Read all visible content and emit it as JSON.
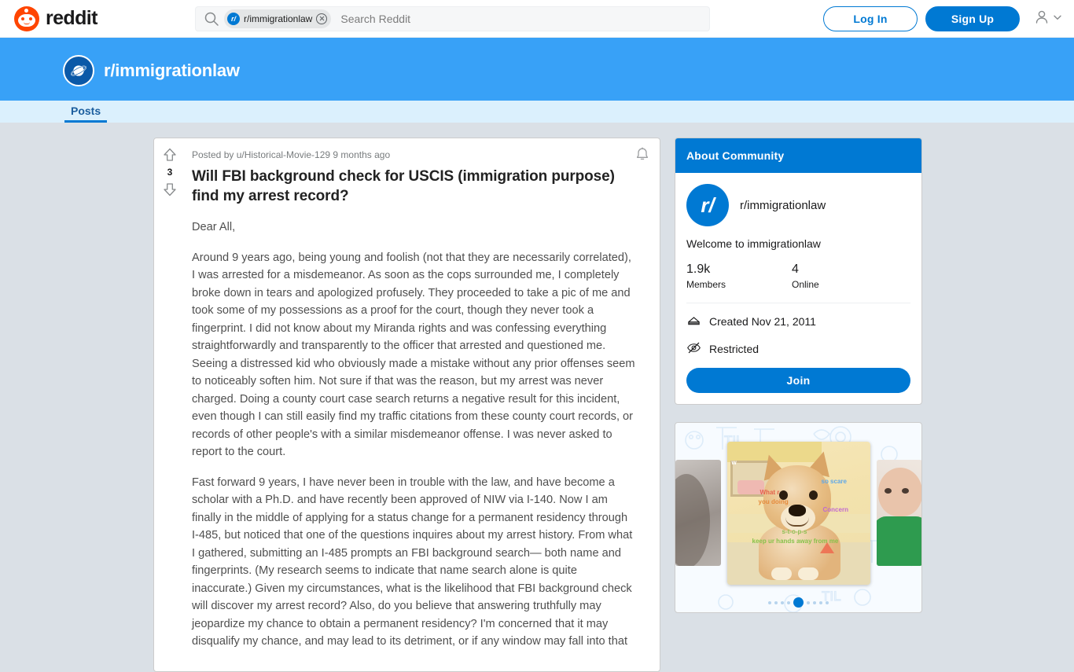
{
  "header": {
    "brand_name": "reddit",
    "brand_icon": "reddit-snoo-icon",
    "search": {
      "icon": "search-icon",
      "pill_avatar_text": "r/",
      "pill_label": "r/immigrationlaw",
      "close_icon": "close-icon",
      "placeholder": "Search Reddit",
      "value": ""
    },
    "login_label": "Log In",
    "signup_label": "Sign Up",
    "user_icon": "user-avatar-icon",
    "chevron_icon": "chevron-down-icon"
  },
  "banner": {
    "icon": "planet-icon",
    "title": "r/immigrationlaw",
    "background_color": "#38a1f7"
  },
  "tabs": [
    {
      "label": "Posts",
      "active": true
    }
  ],
  "post": {
    "vote": {
      "up_icon": "upvote-arrow-icon",
      "down_icon": "downvote-arrow-icon",
      "score": "3"
    },
    "notify_icon": "bell-icon",
    "meta": "Posted by u/Historical-Movie-129 9 months ago",
    "title": "Will FBI background check for USCIS (immigration purpose) find my arrest record?",
    "paragraphs": [
      "Dear All,",
      "Around 9 years ago, being young and foolish (not that they are necessarily correlated), I was arrested for a misdemeanor. As soon as the cops surrounded me, I completely broke down in tears and apologized profusely. They proceeded to take a pic of me and took some of my possessions as a proof for the court, though they never took a fingerprint. I did not know about my Miranda rights and was confessing everything straightforwardly and transparently to the officer that arrested and questioned me. Seeing a distressed kid who obviously made a mistake without any prior offenses seem to noticeably soften him. Not sure if that was the reason, but my arrest was never charged. Doing a county court case search returns a negative result for this incident, even though I can still easily find my traffic citations from these county court records, or records of other people's with a similar misdemeanor offense. I was never asked to report to the court.",
      "Fast forward 9 years, I have never been in trouble with the law, and have become a scholar with a Ph.D. and have recently been approved of NIW via I-140. Now I am finally in the middle of applying for a status change for a permanent residency through I-485, but noticed that one of the questions inquires about my arrest history. From what I gathered, submitting an I-485 prompts an FBI background search— both name and fingerprints. (My research seems to indicate that name search alone is quite inaccurate.) Given my circumstances, what is the likelihood that FBI background check will discover my arrest record? Also, do you believe that answering truthfully may jeopardize my chance to obtain a permanent residency? I'm concerned that it may disqualify my chance, and may lead to its detriment, or if any window may fall into that"
    ]
  },
  "sidebar": {
    "about": {
      "header": "About Community",
      "avatar_text": "r/",
      "community_name": "r/immigrationlaw",
      "description": "Welcome to immigrationlaw",
      "stats": [
        {
          "value": "1.9k",
          "label": "Members"
        },
        {
          "value": "4",
          "label": "Online"
        }
      ],
      "created_icon": "cake-icon",
      "created_text": "Created Nov 21, 2011",
      "privacy_icon": "eye-off-icon",
      "privacy_text": "Restricted",
      "join_label": "Join"
    },
    "promo": {
      "main_image_alt": "doge-meme-image",
      "left_image_alt": "carousel-previous-image",
      "right_image_alt": "carousel-next-image",
      "captions": {
        "c1": "What r",
        "c2": "you doing",
        "c3": "so scare",
        "c4": "Concern",
        "c5": "s-t-o-p-s",
        "c6": "keep ur hands away from me",
        "c7": "w"
      },
      "dots_total": 9,
      "active_dot": 5
    }
  },
  "colors": {
    "accent": "#0079d3",
    "banner": "#38a1f7",
    "page_bg": "#dae0e6",
    "brand_orange": "#ff4500"
  }
}
